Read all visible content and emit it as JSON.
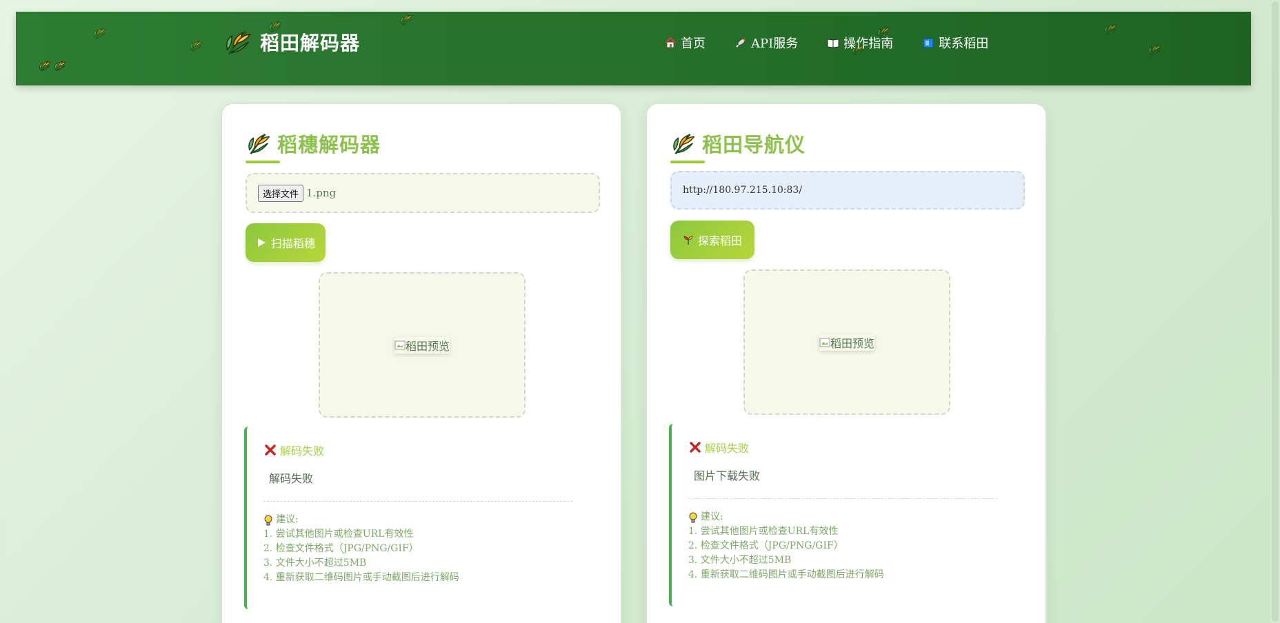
{
  "header": {
    "title": "稻田解码器",
    "nav": [
      {
        "label": "首页",
        "icon": "house-icon"
      },
      {
        "label": "API服务",
        "icon": "satellite-icon"
      },
      {
        "label": "操作指南",
        "icon": "book-icon"
      },
      {
        "label": "联系稻田",
        "icon": "mailbox-icon"
      }
    ]
  },
  "decoder_card": {
    "title": "稻穗解码器",
    "file_button": "选择文件",
    "file_name": "1.png",
    "scan_button": "扫描稻穗",
    "preview_alt": "稻田预览",
    "result_title": "解码失败",
    "result_message": "解码失败",
    "tips_title": "建议:",
    "tips": [
      "1. 尝试其他图片或检查URL有效性",
      "2. 检查文件格式（JPG/PNG/GIF）",
      "3. 文件大小不超过5MB",
      "4. 重新获取二维码图片或手动截图后进行解码"
    ]
  },
  "navigator_card": {
    "title": "稻田导航仪",
    "url_value": "http://180.97.215.10:83/",
    "explore_button": "探索稻田",
    "preview_alt": "稻田预览",
    "result_title": "解码失败",
    "result_message": "图片下载失败",
    "tips_title": "建议:",
    "tips": [
      "1. 尝试其他图片或检查URL有效性",
      "2. 检查文件格式（JPG/PNG/GIF）",
      "3. 文件大小不超过5MB",
      "4. 重新获取二维码图片或手动截图后进行解码"
    ]
  },
  "colors": {
    "header_green": "#2f7d33",
    "title_green": "#8cc24c",
    "button_green": "#8dc83e",
    "border_green": "#4caf50"
  }
}
